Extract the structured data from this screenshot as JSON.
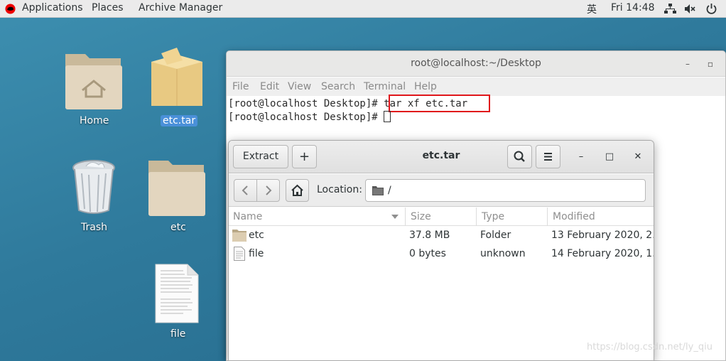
{
  "topbar": {
    "applications": "Applications",
    "places": "Places",
    "app_name": "Archive Manager",
    "input_method": "英",
    "clock": "Fri 14:48"
  },
  "desktop": {
    "icons": [
      {
        "label": "Home"
      },
      {
        "label": "etc.tar"
      },
      {
        "label": "Trash"
      },
      {
        "label": "etc"
      },
      {
        "label": "file"
      }
    ]
  },
  "terminal": {
    "title": "root@localhost:~/Desktop",
    "menu": [
      "File",
      "Edit",
      "View",
      "Search",
      "Terminal",
      "Help"
    ],
    "prompt": "[root@localhost Desktop]# ",
    "command": "tar xf etc.tar",
    "prompt2": "[root@localhost Desktop]# "
  },
  "archive": {
    "title": "etc.tar",
    "extract_label": "Extract",
    "add_label": "+",
    "location_label": "Location:",
    "location_value": "/",
    "columns": [
      "Name",
      "Size",
      "Type",
      "Modified"
    ],
    "rows": [
      {
        "name": "etc",
        "size": "37.8 MB",
        "type": "Folder",
        "modified": "13 February 2020, 2..."
      },
      {
        "name": "file",
        "size": "0 bytes",
        "type": "unknown",
        "modified": "14 February 2020, 1..."
      }
    ]
  },
  "watermark": "https://blog.csdn.net/ly_qiu",
  "colors": {
    "highlight": "#e0161b",
    "selection": "#4a90d9",
    "desktop": "#2f7a9c"
  }
}
